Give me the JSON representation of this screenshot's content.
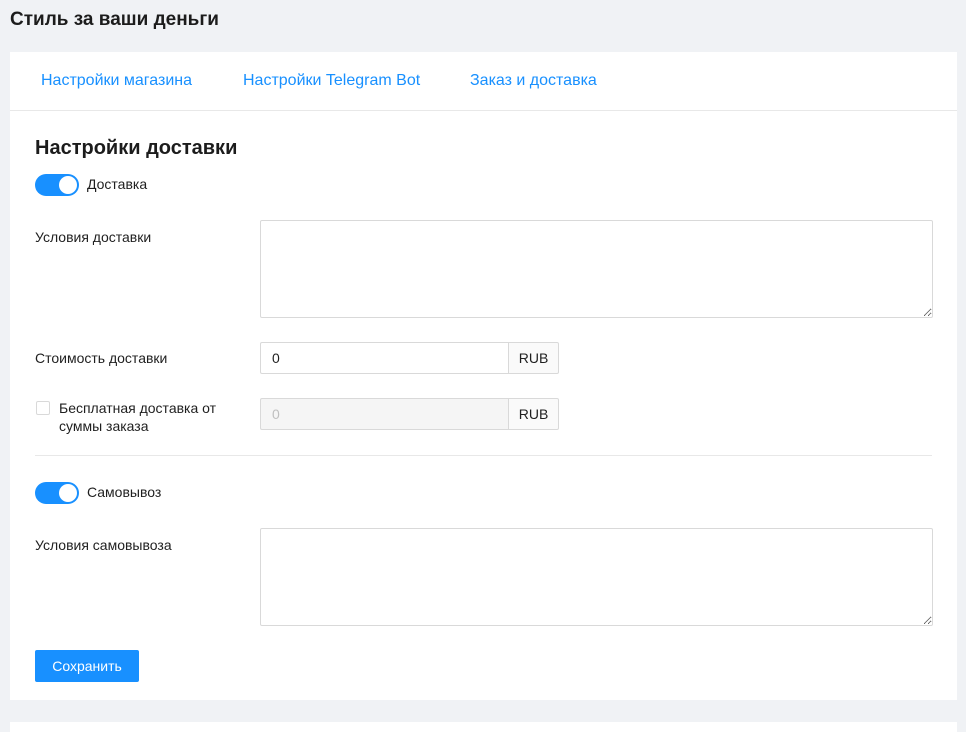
{
  "app": {
    "title": "Стиль за ваши деньги"
  },
  "tabs": [
    {
      "label": "Настройки магазина"
    },
    {
      "label": "Настройки Telegram Bot"
    },
    {
      "label": "Заказ и доставка"
    }
  ],
  "delivery": {
    "section_title": "Настройки доставки",
    "toggle_label": "Доставка",
    "toggle_on": true,
    "conditions_label": "Условия доставки",
    "conditions_value": "",
    "cost_label": "Стоимость доставки",
    "cost_value": "0",
    "cost_currency": "RUB",
    "free_label": "Бесплатная доставка от суммы заказа",
    "free_checked": false,
    "free_value": "0",
    "free_currency": "RUB"
  },
  "pickup": {
    "toggle_label": "Самовывоз",
    "toggle_on": true,
    "conditions_label": "Условия самовывоза",
    "conditions_value": ""
  },
  "actions": {
    "save_label": "Сохранить"
  },
  "colors": {
    "accent": "#1890ff",
    "background": "#f0f2f5",
    "card": "#ffffff"
  }
}
